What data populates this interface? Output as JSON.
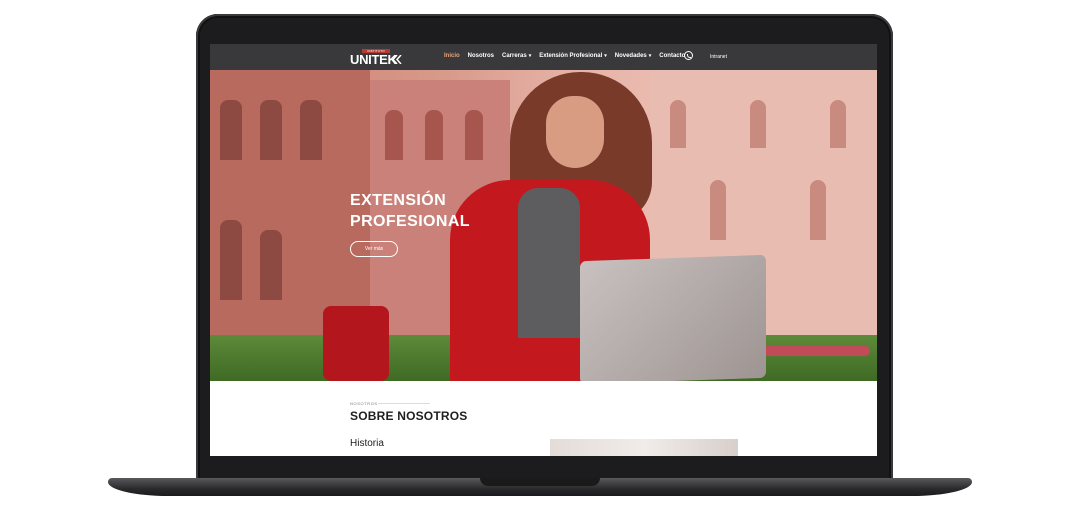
{
  "nav": {
    "logo_badge": "INSTITUTO",
    "logo_text": "UNITEK",
    "items": [
      {
        "label": "Inicio",
        "active": true,
        "dropdown": false
      },
      {
        "label": "Nosotros",
        "active": false,
        "dropdown": false
      },
      {
        "label": "Carreras",
        "active": false,
        "dropdown": true
      },
      {
        "label": "Extensión Profesional",
        "active": false,
        "dropdown": true
      },
      {
        "label": "Novedades",
        "active": false,
        "dropdown": true
      },
      {
        "label": "Contacto",
        "active": false,
        "dropdown": false
      }
    ],
    "whatsapp_icon": "whatsapp-icon",
    "intranet_label": "Intranet"
  },
  "hero": {
    "title_line1": "EXTENSIÓN",
    "title_line2": "PROFESIONAL",
    "button_label": "Ver más"
  },
  "about": {
    "eyebrow": "NOSOTROS",
    "title": "SOBRE NOSOTROS",
    "subtitle": "Historia"
  },
  "colors": {
    "accent": "#c4181f",
    "nav_active": "#e8a47b",
    "nav_bg": "#28282a"
  }
}
